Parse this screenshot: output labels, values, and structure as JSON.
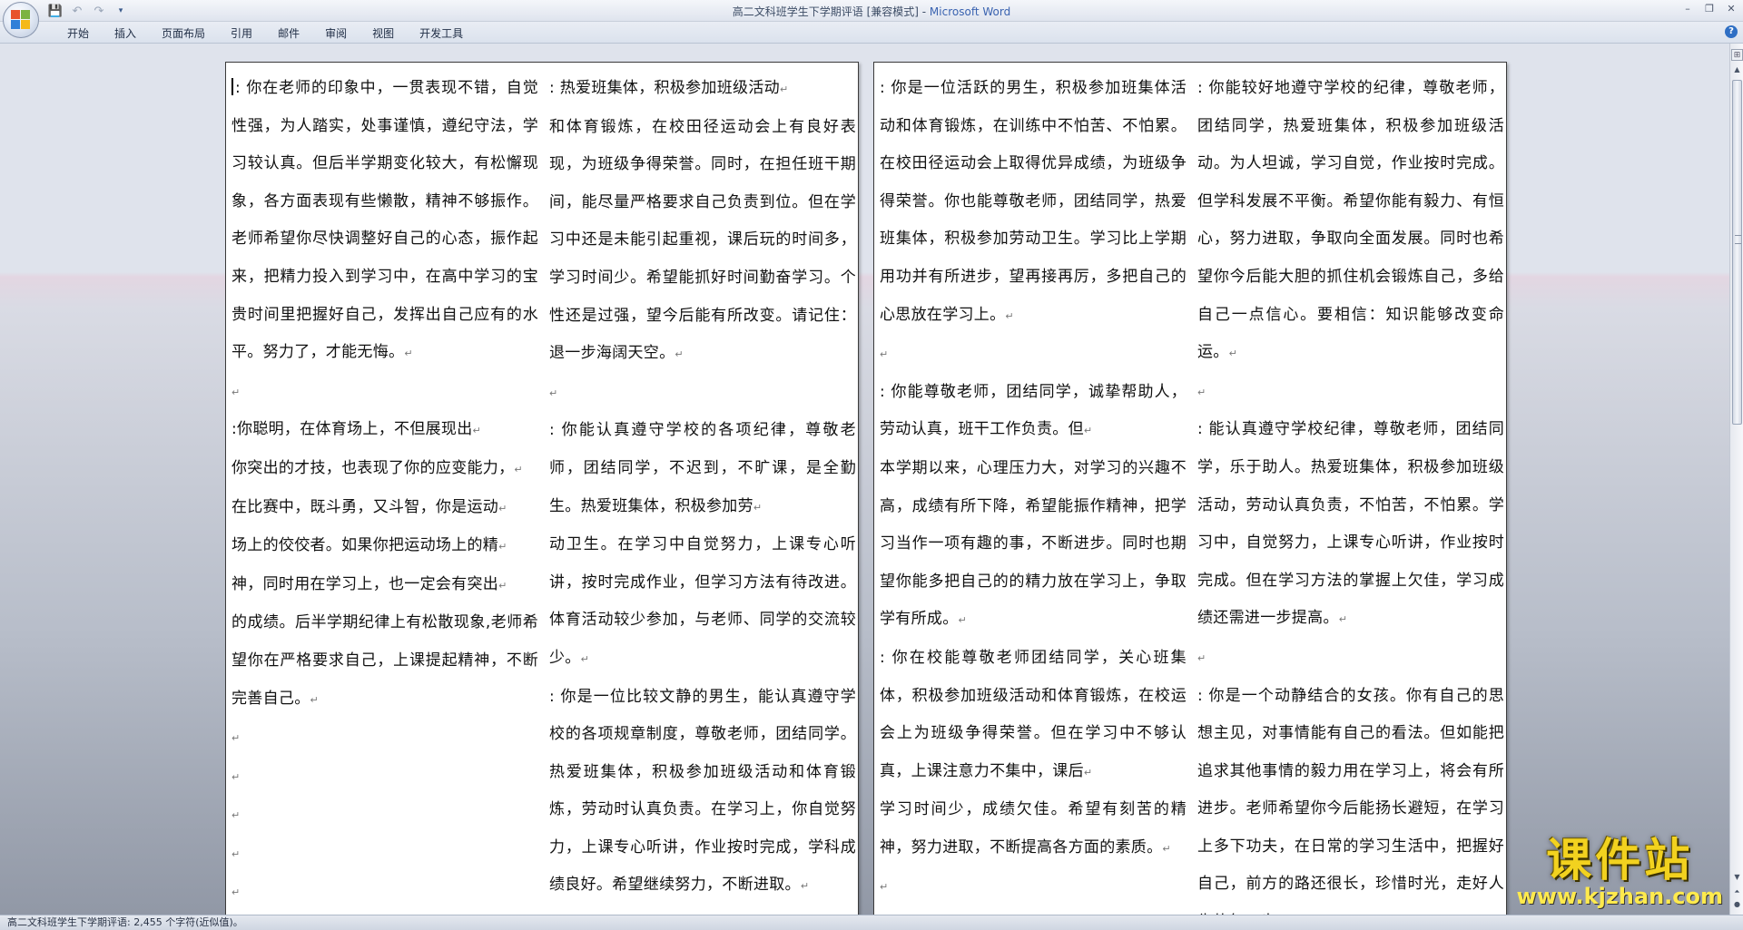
{
  "window": {
    "title_doc": "高二文科班学生下学期评语 [兼容模式] - ",
    "title_app": "Microsoft Word"
  },
  "qat": {
    "save_icon": "save-icon",
    "undo_icon": "undo-icon",
    "redo_icon": "redo-icon",
    "customize_icon": "dropdown-icon"
  },
  "window_controls": {
    "minimize": "–",
    "restore": "❐",
    "close": "✕"
  },
  "ribbon": {
    "tabs": [
      {
        "label": "开始"
      },
      {
        "label": "插入"
      },
      {
        "label": "页面布局"
      },
      {
        "label": "引用"
      },
      {
        "label": "邮件"
      },
      {
        "label": "审阅"
      },
      {
        "label": "视图"
      },
      {
        "label": "开发工具"
      }
    ],
    "help": "?"
  },
  "document": {
    "page1": {
      "col1": [
        ": 你在老师的印象中，一贯表现不错，自觉性强，为人踏实，处事谨慎，遵纪守法，学习较认真。但后半学期变化较大，有松懈现象，各方面表现有些懒散，精神不够振作。老师希望你尽快调整好自己的心态，振作起来，把精力投入到学习中，在高中学习的宝贵时间里把握好自己，发挥出自己应有的水平。努力了，才能无悔。",
        "",
        ":你聪明，在体育场上，不但展现出",
        "你突出的才技，也表现了你的应变能力，",
        "在比赛中，既斗勇，又斗智，你是运动",
        "场上的佼佼者。如果你把运动场上的精",
        "神，同时用在学习上，也一定会有突出",
        "的成绩。后半学期纪律上有松散现象,老师希望你在严格要求自己，上课提起精神，不断完善自己。",
        "",
        "",
        "",
        "",
        ""
      ],
      "col2": [
        ": 热爱班集体，积极参加班级活动",
        "和体育锻炼，在校田径运动会上有良好表现，为班级争得荣誉。同时，在担任班干期间，能尽量严格要求自己负责到位。但在学习中还是未能引起重视，课后玩的时间多，学习时间少。希望能抓好时间勤奋学习。个性还是过强，望今后能有所改变。请记住：退一步海阔天空。",
        "",
        ": 你能认真遵守学校的各项纪律，尊敬老师，团结同学，不迟到，不旷课，是全勤生。热爱班集体，积极参加劳",
        "动卫生。在学习中自觉努力，上课专心听讲，按时完成作业，但学习方法有待改进。体育活动较少参加，与老师、同学的交流较少。",
        ": 你是一位比较文静的男生，能认真遵守学校的各项规章制度，尊敬老师，团结同学。热爱班集体，积极参加班级活动和体育锻炼，劳动时认真负责。在学习上，你自觉努力，上课专心听讲，作业按时完成，学科成绩良好。希望继续努力，不断进取。"
      ]
    },
    "page2": {
      "col1": [
        ": 你是一位活跃的男生，积极参加班集体活动和体育锻炼，在训练中不怕苦、不怕累。在校田径运动会上取得优异成绩，为班级争得荣誉。你也能尊敬老师，团结同学，热爱班集体，积极参加劳动卫生。学习比上学期用功并有所进步，望再接再厉，多把自己的心思放在学习上。",
        "",
        ": 你能尊敬老师，团结同学，诚挚帮助人，劳动认真，班干工作负责。但",
        "本学期以来，心理压力大，对学习的兴趣不高，成绩有所下降，希望能振作精神，把学习当作一项有趣的事，不断进步。同时也期望你能多把自己的的精力放在学习上，争取学有所成。",
        ": 你在校能尊敬老师团结同学，关心班集体，积极参加班级活动和体育锻炼，在校运会上为班级争得荣誉。但在学习中不够认真，上课注意力不集中，课后",
        "学习时间少，成绩欠佳。希望有刻苦的精神，努力进取，不断提高各方面的素质。",
        ""
      ],
      "col2": [
        ": 你能较好地遵守学校的纪律，尊敬老师，团结同学，热爱班集体，积极参加班级活动。为人坦诚，学习自觉，作业按时完成。但学科发展不平衡。希望你能有毅力、有恒心，努力进取，争取向全面发展。同时也希望你今后能大胆的抓住机会锻炼自己，多给自己一点信心。要相信：知识能够改变命运。",
        "",
        ": 能认真遵守学校纪律，尊敬老师，团结同学，乐于助人。热爱班集体，积极参加班级活动，劳动认真负责，不怕苦，不怕累。学习中，自觉努力，上课专心听讲，作业按时完成。但在学习方法的掌握上欠佳，学习成绩还需进一步提高。",
        "",
        ": 你是一个动静结合的女孩。你有自己的思想主见，对事情能有自己的看法。但如能把追求其他事情的毅力用在学习上，将会有所进步。老师希望你今后能扬长避短，在学习上多下功夫，在日常的学习生活中，把握好自己，前方的路还很长，珍惜时光，走好人生的每一步。"
      ]
    }
  },
  "status": {
    "text": "高二文科班学生下学期评语: 2,455 个字符(近似值)。"
  },
  "watermark": {
    "title": "课件站",
    "url": "www.kjzhan.com"
  }
}
